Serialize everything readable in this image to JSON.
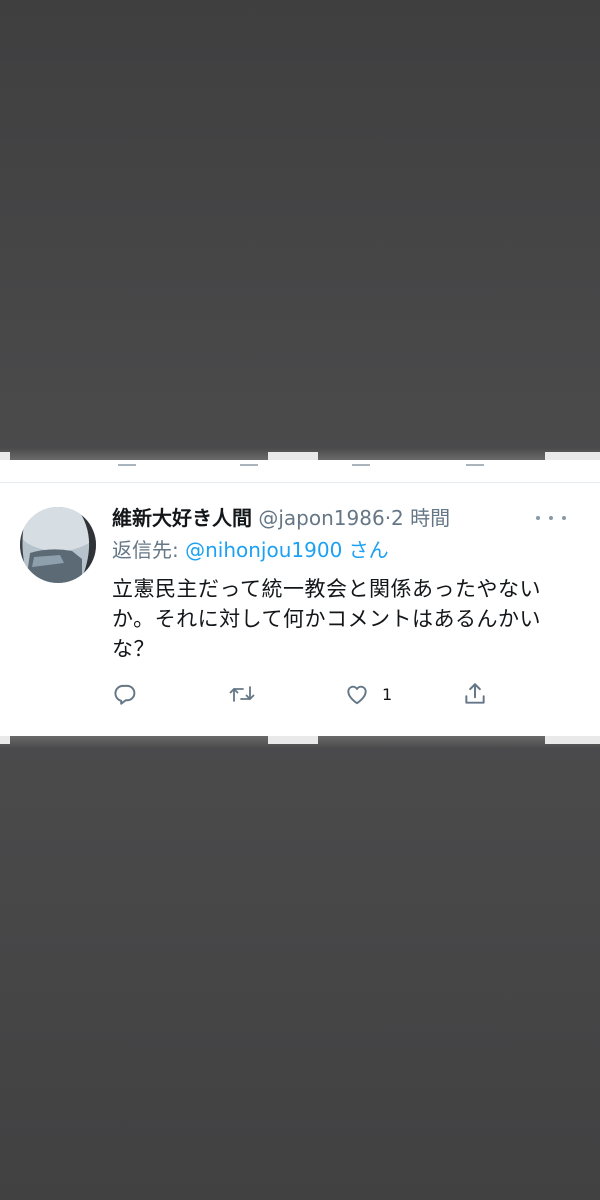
{
  "tweet": {
    "display_name": "維新大好き人間",
    "handle": "@japon1986",
    "separator": "·",
    "time": "2 時間",
    "reply_prefix": "返信先:",
    "reply_mention": "@nihonjou1900 さん",
    "text": "立憲民主だって統一教会と関係あったやないか。それに対して何かコメントはあるんかいな？",
    "reply_count": "",
    "retweet_count": "",
    "like_count": "1"
  },
  "icons": {
    "more": "more-dots-icon",
    "reply": "reply-icon",
    "retweet": "retweet-icon",
    "like": "heart-icon",
    "share": "share-icon"
  },
  "colors": {
    "text": "#14171a",
    "secondary": "#657786",
    "link": "#1da1f2",
    "icon": "#657786"
  }
}
